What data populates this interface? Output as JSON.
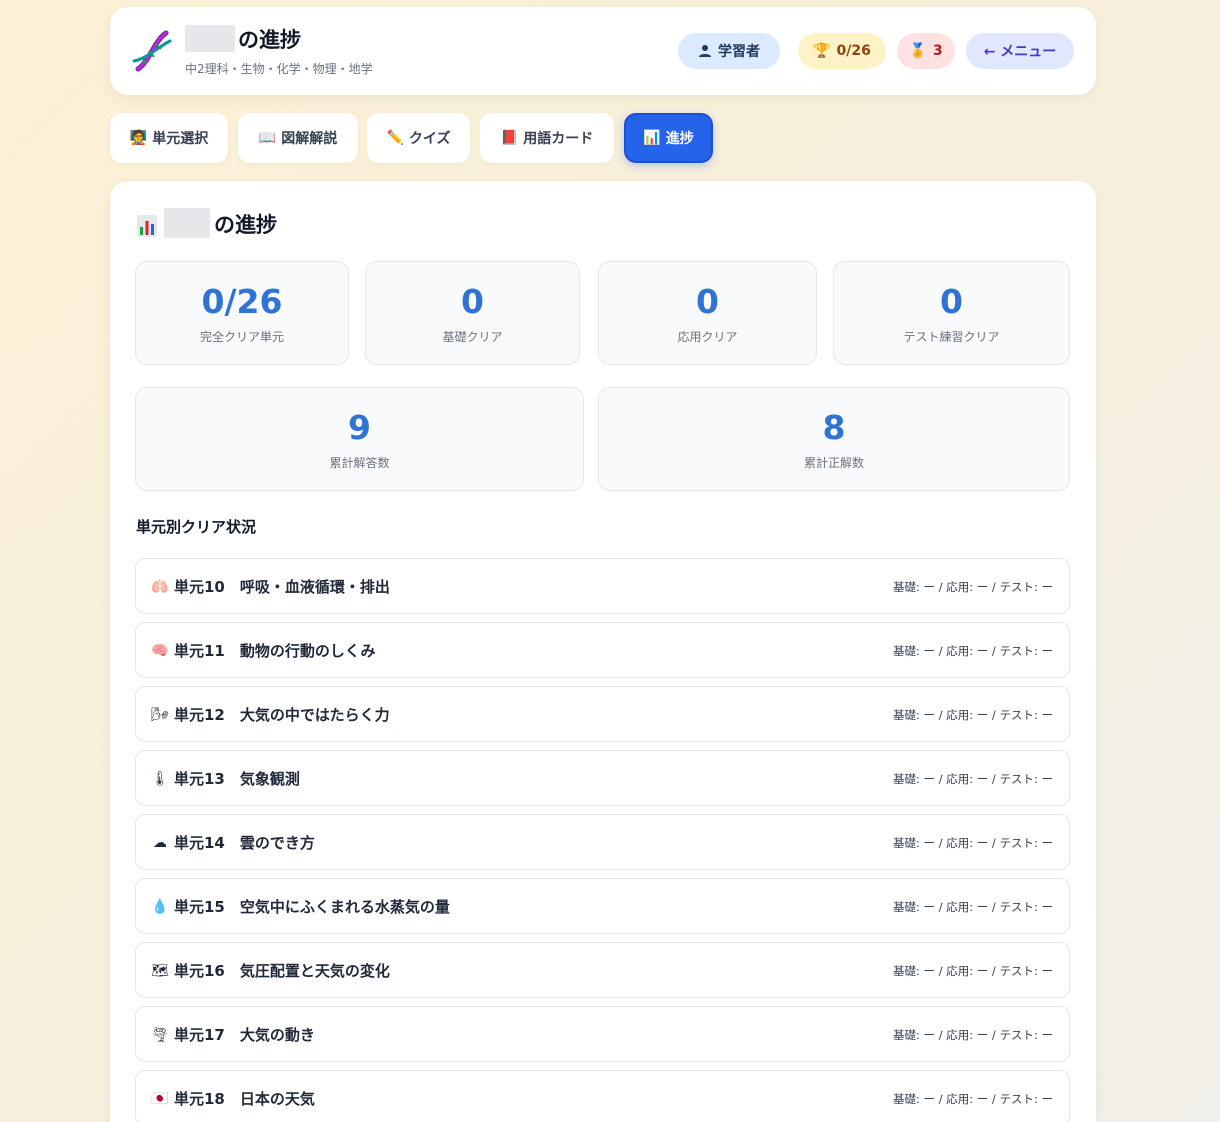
{
  "header": {
    "title": "の進捗",
    "subtitle": "中2理科・生物・化学・物理・地学",
    "user_label": "学習者",
    "trophy_count": "0/26",
    "medal_count": "3",
    "menu_label": "← メニュー"
  },
  "tabs": [
    {
      "icon": "🧑‍🏫",
      "label": "単元選択"
    },
    {
      "icon": "📖",
      "label": "図解解説"
    },
    {
      "icon": "✏️",
      "label": "クイズ"
    },
    {
      "icon": "📕",
      "label": "用語カード"
    },
    {
      "icon": "📊",
      "label": "進捗"
    }
  ],
  "main": {
    "title": "の進捗",
    "stats": [
      {
        "value": "0/26",
        "label": "完全クリア単元"
      },
      {
        "value": "0",
        "label": "基礎クリア"
      },
      {
        "value": "0",
        "label": "応用クリア"
      },
      {
        "value": "0",
        "label": "テスト練習クリア"
      },
      {
        "value": "9",
        "label": "累計解答数"
      },
      {
        "value": "8",
        "label": "累計正解数"
      }
    ],
    "section_title": "単元別クリア状況",
    "units": [
      {
        "icon": "🫁",
        "name": "単元10　呼吸・血液循環・排出",
        "status": "基礎: ー / 応用: ー / テスト: ー"
      },
      {
        "icon": "🧠",
        "name": "単元11　動物の行動のしくみ",
        "status": "基礎: ー / 応用: ー / テスト: ー"
      },
      {
        "icon": "🌬",
        "name": "単元12　大気の中ではたらく力",
        "status": "基礎: ー / 応用: ー / テスト: ー"
      },
      {
        "icon": "🌡",
        "name": "単元13　気象観測",
        "status": "基礎: ー / 応用: ー / テスト: ー"
      },
      {
        "icon": "☁",
        "name": "単元14　雲のでき方",
        "status": "基礎: ー / 応用: ー / テスト: ー"
      },
      {
        "icon": "💧",
        "name": "単元15　空気中にふくまれる水蒸気の量",
        "status": "基礎: ー / 応用: ー / テスト: ー"
      },
      {
        "icon": "🗺",
        "name": "単元16　気圧配置と天気の変化",
        "status": "基礎: ー / 応用: ー / テスト: ー"
      },
      {
        "icon": "🌪",
        "name": "単元17　大気の動き",
        "status": "基礎: ー / 応用: ー / テスト: ー"
      },
      {
        "icon": "🇯🇵",
        "name": "単元18　日本の天気",
        "status": "基礎: ー / 応用: ー / テスト: ー"
      }
    ]
  }
}
